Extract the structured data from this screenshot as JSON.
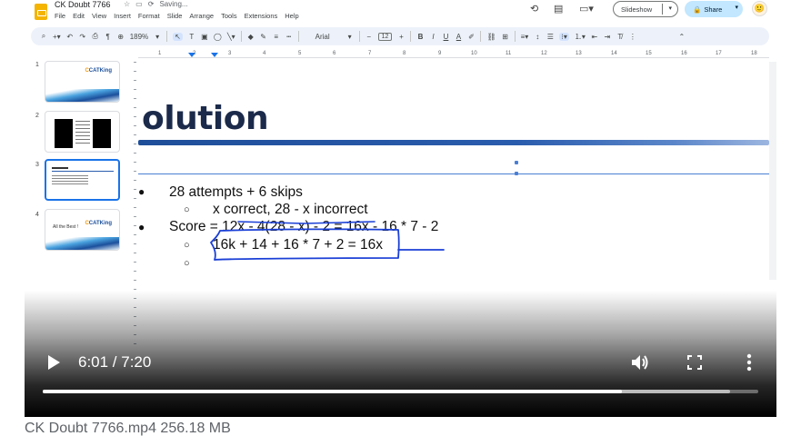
{
  "docs": {
    "title": "CK Doubt 7766",
    "saving_status": "Saving...",
    "menu": [
      "File",
      "Edit",
      "View",
      "Insert",
      "Format",
      "Slide",
      "Arrange",
      "Tools",
      "Extensions",
      "Help"
    ],
    "slideshow_label": "Slideshow",
    "share_label": "Share",
    "toolbar": {
      "zoom": "189%",
      "font": "Arial",
      "font_size": "12",
      "bold": "B",
      "italic": "I",
      "underline": "U",
      "text_color": "A"
    },
    "ruler_ticks": [
      "1",
      "2",
      "3",
      "4",
      "5",
      "6",
      "7",
      "8",
      "9",
      "10",
      "11",
      "12",
      "13",
      "14",
      "15",
      "16",
      "17",
      "18"
    ]
  },
  "filmstrip": {
    "slides": [
      {
        "number": "1",
        "logo": "CATKing"
      },
      {
        "number": "2",
        "logo": ""
      },
      {
        "number": "3",
        "logo": ""
      },
      {
        "number": "4",
        "logo": "CATKing",
        "caption": "All the Best !"
      }
    ]
  },
  "slide": {
    "title": "olution",
    "bullets": [
      {
        "level": 1,
        "text": "28 attempts + 6 skips"
      },
      {
        "level": 2,
        "text": "x correct, 28 - x incorrect"
      },
      {
        "level": 1,
        "text": "Score = 12x - 4(28 - x) - 2 = 16x - 16 * 7 - 2"
      },
      {
        "level": 2,
        "text": "16k + 14 + 16 * 7 + 2 = 16x"
      },
      {
        "level": 2,
        "text": ""
      }
    ],
    "ink_color": "#1a3fd6"
  },
  "player": {
    "time_display": "6:01 / 7:20",
    "played_fraction": 0.81,
    "buffered_fraction": 0.96,
    "icons": [
      "play-icon",
      "volume-icon",
      "fullscreen-icon",
      "more-vert-icon"
    ]
  },
  "file": {
    "caption": "CK Doubt 7766.mp4 256.18 MB"
  }
}
